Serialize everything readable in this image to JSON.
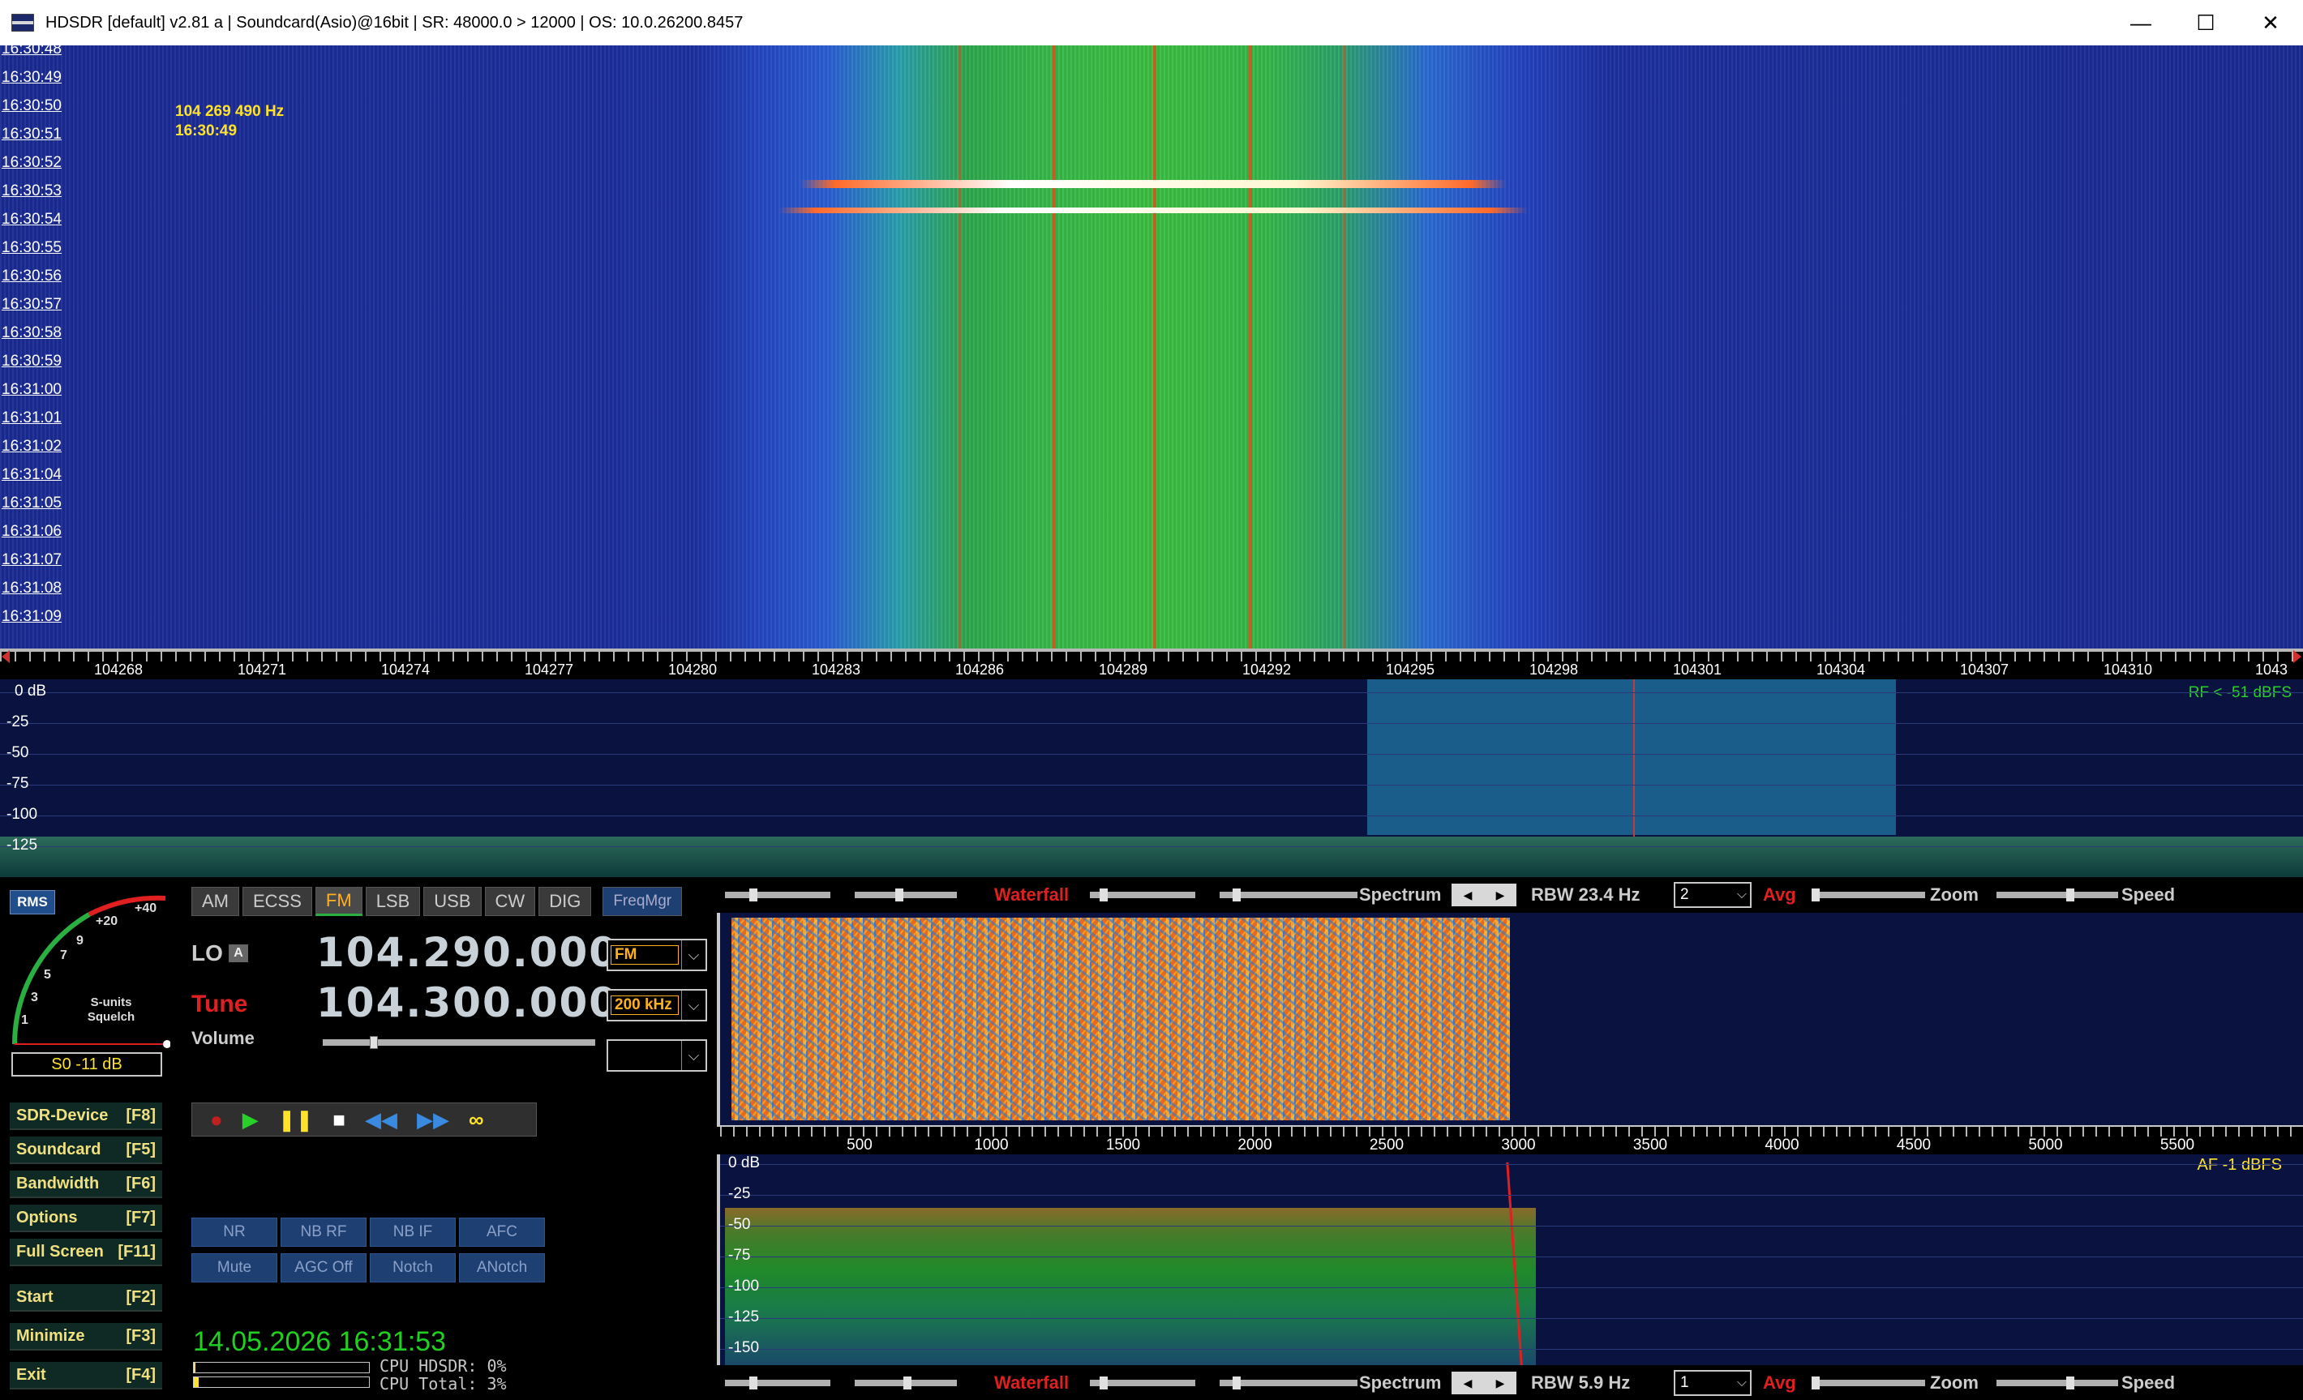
{
  "window": {
    "title": "HDSDR  [default]  v2.81 a  |  Soundcard(Asio)@16bit  |  SR: 48000.0 > 12000  |  OS: 10.0.26200.8457",
    "minimize": "—",
    "maximize": "☐",
    "close": "✕"
  },
  "waterfall": {
    "times": [
      "16:30:48",
      "16:30:49",
      "16:30:50",
      "16:30:51",
      "16:30:52",
      "16:30:53",
      "16:30:54",
      "16:30:55",
      "16:30:56",
      "16:30:57",
      "16:30:58",
      "16:30:59",
      "16:31:00",
      "16:31:01",
      "16:31:02",
      "16:31:04",
      "16:31:05",
      "16:31:06",
      "16:31:07",
      "16:31:08",
      "16:31:09"
    ],
    "cursor_freq": "104 269 490 Hz",
    "cursor_time": "16:30:49"
  },
  "freq_axis": {
    "labels": [
      "104268",
      "104271",
      "104274",
      "104277",
      "104280",
      "104283",
      "104286",
      "104289",
      "104292",
      "104295",
      "104298",
      "104301",
      "104304",
      "104307",
      "104310",
      "1043"
    ]
  },
  "rf_spectrum": {
    "db_labels": [
      "0 dB",
      "-25",
      "-50",
      "-75",
      "-100",
      "-125"
    ],
    "status": "RF < -51 dBFS"
  },
  "smeter": {
    "rms": "RMS",
    "scale": [
      "+40",
      "+20",
      "9",
      "7",
      "5",
      "3",
      "1"
    ],
    "label1": "S-units",
    "label2": "Squelch",
    "readout": "S0 -11 dB"
  },
  "modes": {
    "am": "AM",
    "ecss": "ECSS",
    "fm": "FM",
    "lsb": "LSB",
    "usb": "USB",
    "cw": "CW",
    "dig": "DIG",
    "freqmgr": "FreqMgr"
  },
  "tuning": {
    "lo_label": "LO",
    "lo_a": "A",
    "lo_freq": "104.290.000",
    "tune_label": "Tune",
    "tune_freq": "104.300.000",
    "demod": "FM",
    "bandwidth": "200 kHz",
    "volume_label": "Volume",
    "extra": ""
  },
  "side_buttons": [
    {
      "label": "SDR-Device",
      "key": "[F8]"
    },
    {
      "label": "Soundcard",
      "key": "[F5]"
    },
    {
      "label": "Bandwidth",
      "key": "[F6]"
    },
    {
      "label": "Options",
      "key": "[F7]"
    },
    {
      "label": "Full Screen",
      "key": "[F11]"
    },
    {
      "label": "Start",
      "key": "[F2]"
    },
    {
      "label": "Minimize",
      "key": "[F3]"
    },
    {
      "label": "Exit",
      "key": "[F4]"
    }
  ],
  "dsp": {
    "nr": "NR",
    "nb_rf": "NB RF",
    "nb_if": "NB IF",
    "afc": "AFC",
    "mute": "Mute",
    "agc": "AGC Off",
    "notch": "Notch",
    "anotch": "ANotch"
  },
  "status": {
    "datetime": "14.05.2026 16:31:53",
    "cpu_hdsdr": "CPU HDSDR: 0%",
    "cpu_total": "CPU Total: 3%",
    "cpu_hdsdr_value": 0,
    "cpu_total_value": 3
  },
  "rf_controls": {
    "waterfall": "Waterfall",
    "spectrum": "Spectrum",
    "rbw": "RBW 23.4 Hz",
    "avg_value": "2",
    "avg": "Avg",
    "zoom": "Zoom",
    "speed": "Speed"
  },
  "af_controls": {
    "waterfall": "Waterfall",
    "spectrum": "Spectrum",
    "rbw": "RBW  5.9 Hz",
    "avg_value": "1",
    "avg": "Avg",
    "zoom": "Zoom",
    "speed": "Speed"
  },
  "af_axis": {
    "labels": [
      "500",
      "1000",
      "1500",
      "2000",
      "2500",
      "3000",
      "3500",
      "4000",
      "4500",
      "5000",
      "5500"
    ]
  },
  "af_spectrum": {
    "db_labels": [
      "0 dB",
      "-25",
      "-50",
      "-75",
      "-100",
      "-125",
      "-150"
    ],
    "status": "AF  -1 dBFS"
  },
  "colors": {
    "accent_yellow": "#ffe22a",
    "tune_red": "#e02020",
    "clock_green": "#20d020",
    "rf_status_green": "#2ad02a"
  }
}
